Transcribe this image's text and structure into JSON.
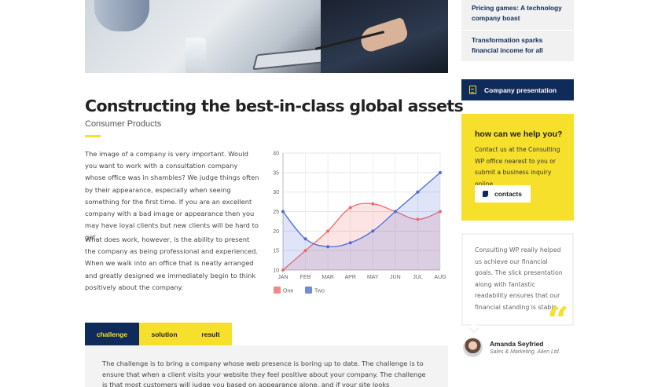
{
  "article": {
    "title": "Constructing the best-in-class global assets",
    "category": "Consumer Products",
    "paragraphs": [
      "The image of a company is very important. Would you want to work with a consultation company whose office was in shambles? We judge things often by their appearance, especially when seeing something for the first time. If you are an excellent company with a bad image or appearance then you may have loyal clients but new clients will be hard to get.",
      "What does work, however, is the ability to present the company as being professional and experienced. When we walk into an office that is neatly arranged and greatly designed we immediately begin to think positively about the company."
    ]
  },
  "chart_data": {
    "type": "area",
    "categories": [
      "JAN",
      "FEB",
      "MAR",
      "APR",
      "MAY",
      "JUN",
      "JUL",
      "AUG"
    ],
    "series": [
      {
        "name": "One",
        "values": [
          10,
          15,
          20,
          26,
          27,
          25,
          23,
          25
        ],
        "color": "#f06a6a"
      },
      {
        "name": "Two",
        "values": [
          25,
          18,
          16,
          17,
          20,
          25,
          30,
          35
        ],
        "color": "#4d6bd6"
      }
    ],
    "yticks": [
      10,
      15,
      20,
      25,
      30,
      35,
      40
    ],
    "ylim": [
      10,
      40
    ],
    "grid": true,
    "legend": "bottom-left"
  },
  "tabs": [
    {
      "label": "challenge",
      "active": true
    },
    {
      "label": "solution",
      "active": false
    },
    {
      "label": "result",
      "active": false
    }
  ],
  "tab_content": "The challenge is to bring a company whose web presence is boring up to date. The challenge is to ensure that when a client visits your website they feel positive about your company. The challenge is that most customers will judge you based on appearance alone, and if your site looks unprofessional or poorly made then they will",
  "sidebar": {
    "news": [
      "Pricing games: A technology company boast",
      "Transformation sparks financial income for all"
    ],
    "presentation_label": "Company presentation",
    "help": {
      "title": "how can we help you?",
      "text": "Contact us at the Consulting WP office nearest to you or submit a business inquiry online.",
      "button_label": "contacts"
    },
    "testimonial": {
      "text": "Consulting WP really helped us achieve our financial goals. The slick presentation along with fantastic readability ensures that our financial standing is stable.",
      "author": "Amanda Seyfried",
      "role": "Sales & Marketing, Alien Ltd."
    }
  },
  "colors": {
    "navy": "#0f2b5b",
    "yellow": "#f7e02b"
  }
}
